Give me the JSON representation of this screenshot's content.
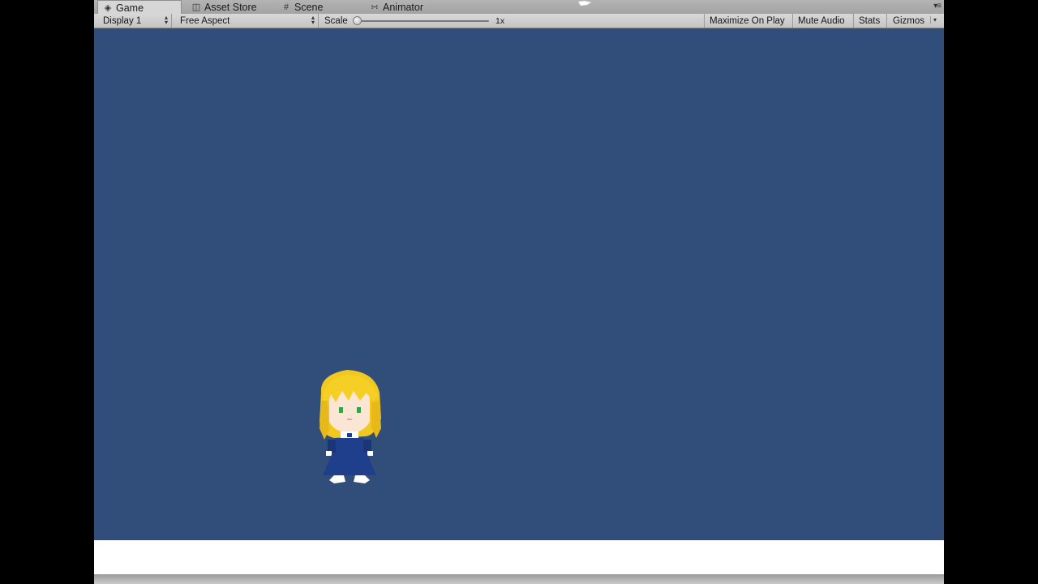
{
  "tabs": [
    {
      "label": "Game",
      "icon": "game-controller-icon",
      "active": true
    },
    {
      "label": "Asset Store",
      "icon": "shopping-bag-icon",
      "active": false
    },
    {
      "label": "Scene",
      "icon": "grid-icon",
      "active": false
    },
    {
      "label": "Animator",
      "icon": "animator-nodes-icon",
      "active": false
    }
  ],
  "toolbar": {
    "display": "Display 1",
    "aspect": "Free Aspect",
    "scale_label": "Scale",
    "scale_value": "1x",
    "scale_fraction": 0.0,
    "maximize_on_play": "Maximize On Play",
    "mute_audio": "Mute Audio",
    "stats": "Stats",
    "gizmos": "Gizmos"
  },
  "colors": {
    "game_background": "#314d79",
    "ground": "#ffffff",
    "hair": "#f0c81e",
    "dress": "#1f3f8c"
  }
}
